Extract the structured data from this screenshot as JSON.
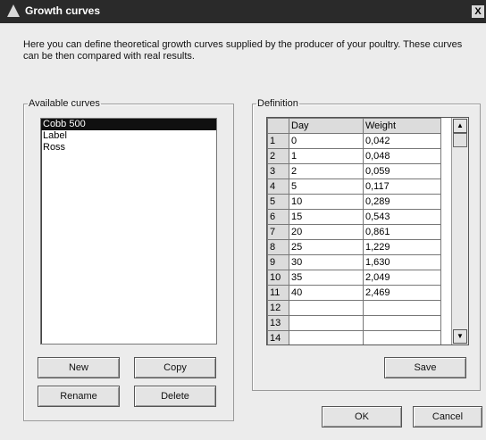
{
  "window": {
    "title": "Growth curves",
    "close_label": "X"
  },
  "intro_text": "Here you can define theoretical growth curves supplied by the producer of your poultry. These curves can be then compared with real results.",
  "available_curves": {
    "legend": "Available curves",
    "items": [
      {
        "label": "Cobb 500",
        "selected": true
      },
      {
        "label": "Label",
        "selected": false
      },
      {
        "label": "Ross",
        "selected": false
      }
    ]
  },
  "buttons": {
    "new": "New",
    "copy": "Copy",
    "rename": "Rename",
    "delete": "Delete",
    "save": "Save",
    "ok": "OK",
    "cancel": "Cancel"
  },
  "definition": {
    "legend": "Definition",
    "columns": [
      "Day",
      "Weight"
    ],
    "rows": [
      {
        "n": "1",
        "day": "0",
        "weight": "0,042"
      },
      {
        "n": "2",
        "day": "1",
        "weight": "0,048"
      },
      {
        "n": "3",
        "day": "2",
        "weight": "0,059"
      },
      {
        "n": "4",
        "day": "5",
        "weight": "0,117"
      },
      {
        "n": "5",
        "day": "10",
        "weight": "0,289"
      },
      {
        "n": "6",
        "day": "15",
        "weight": "0,543"
      },
      {
        "n": "7",
        "day": "20",
        "weight": "0,861"
      },
      {
        "n": "8",
        "day": "25",
        "weight": "1,229"
      },
      {
        "n": "9",
        "day": "30",
        "weight": "1,630"
      },
      {
        "n": "10",
        "day": "35",
        "weight": "2,049"
      },
      {
        "n": "11",
        "day": "40",
        "weight": "2,469"
      },
      {
        "n": "12",
        "day": "",
        "weight": ""
      },
      {
        "n": "13",
        "day": "",
        "weight": ""
      },
      {
        "n": "14",
        "day": "",
        "weight": ""
      }
    ]
  },
  "icons": {
    "window_icon": "app-icon",
    "scroll_up": "▲",
    "scroll_down": "▼"
  }
}
